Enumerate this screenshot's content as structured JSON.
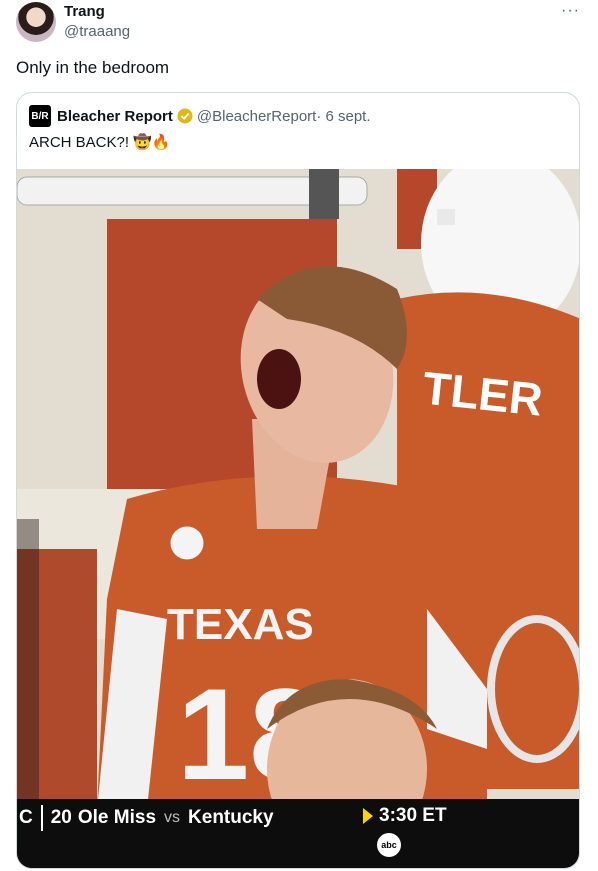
{
  "tweet": {
    "author_name": "Trang",
    "author_handle": "@traaang",
    "text": "Only in the bedroom",
    "more_label": "···"
  },
  "quote": {
    "logo_text": "B/R",
    "name": "Bleacher Report",
    "handle": "@BleacherReport",
    "date": "· 6 sept.",
    "text": "ARCH BACK?! 🤠🔥"
  },
  "media": {
    "jersey_text": "TEXAS",
    "jersey_number": "18",
    "back_name": "TLER",
    "scoreboard": {
      "left_edge": "C",
      "matchup_rank": "20",
      "team1": "Ole Miss",
      "vs": "vs",
      "team2": "Kentucky",
      "time": "3:30 ET",
      "network": "abc"
    }
  },
  "colors": {
    "texas_orange": "#c95a2a",
    "verified_gold": "#e2b719",
    "secondary_text": "#536471",
    "border": "#cfd9de"
  }
}
